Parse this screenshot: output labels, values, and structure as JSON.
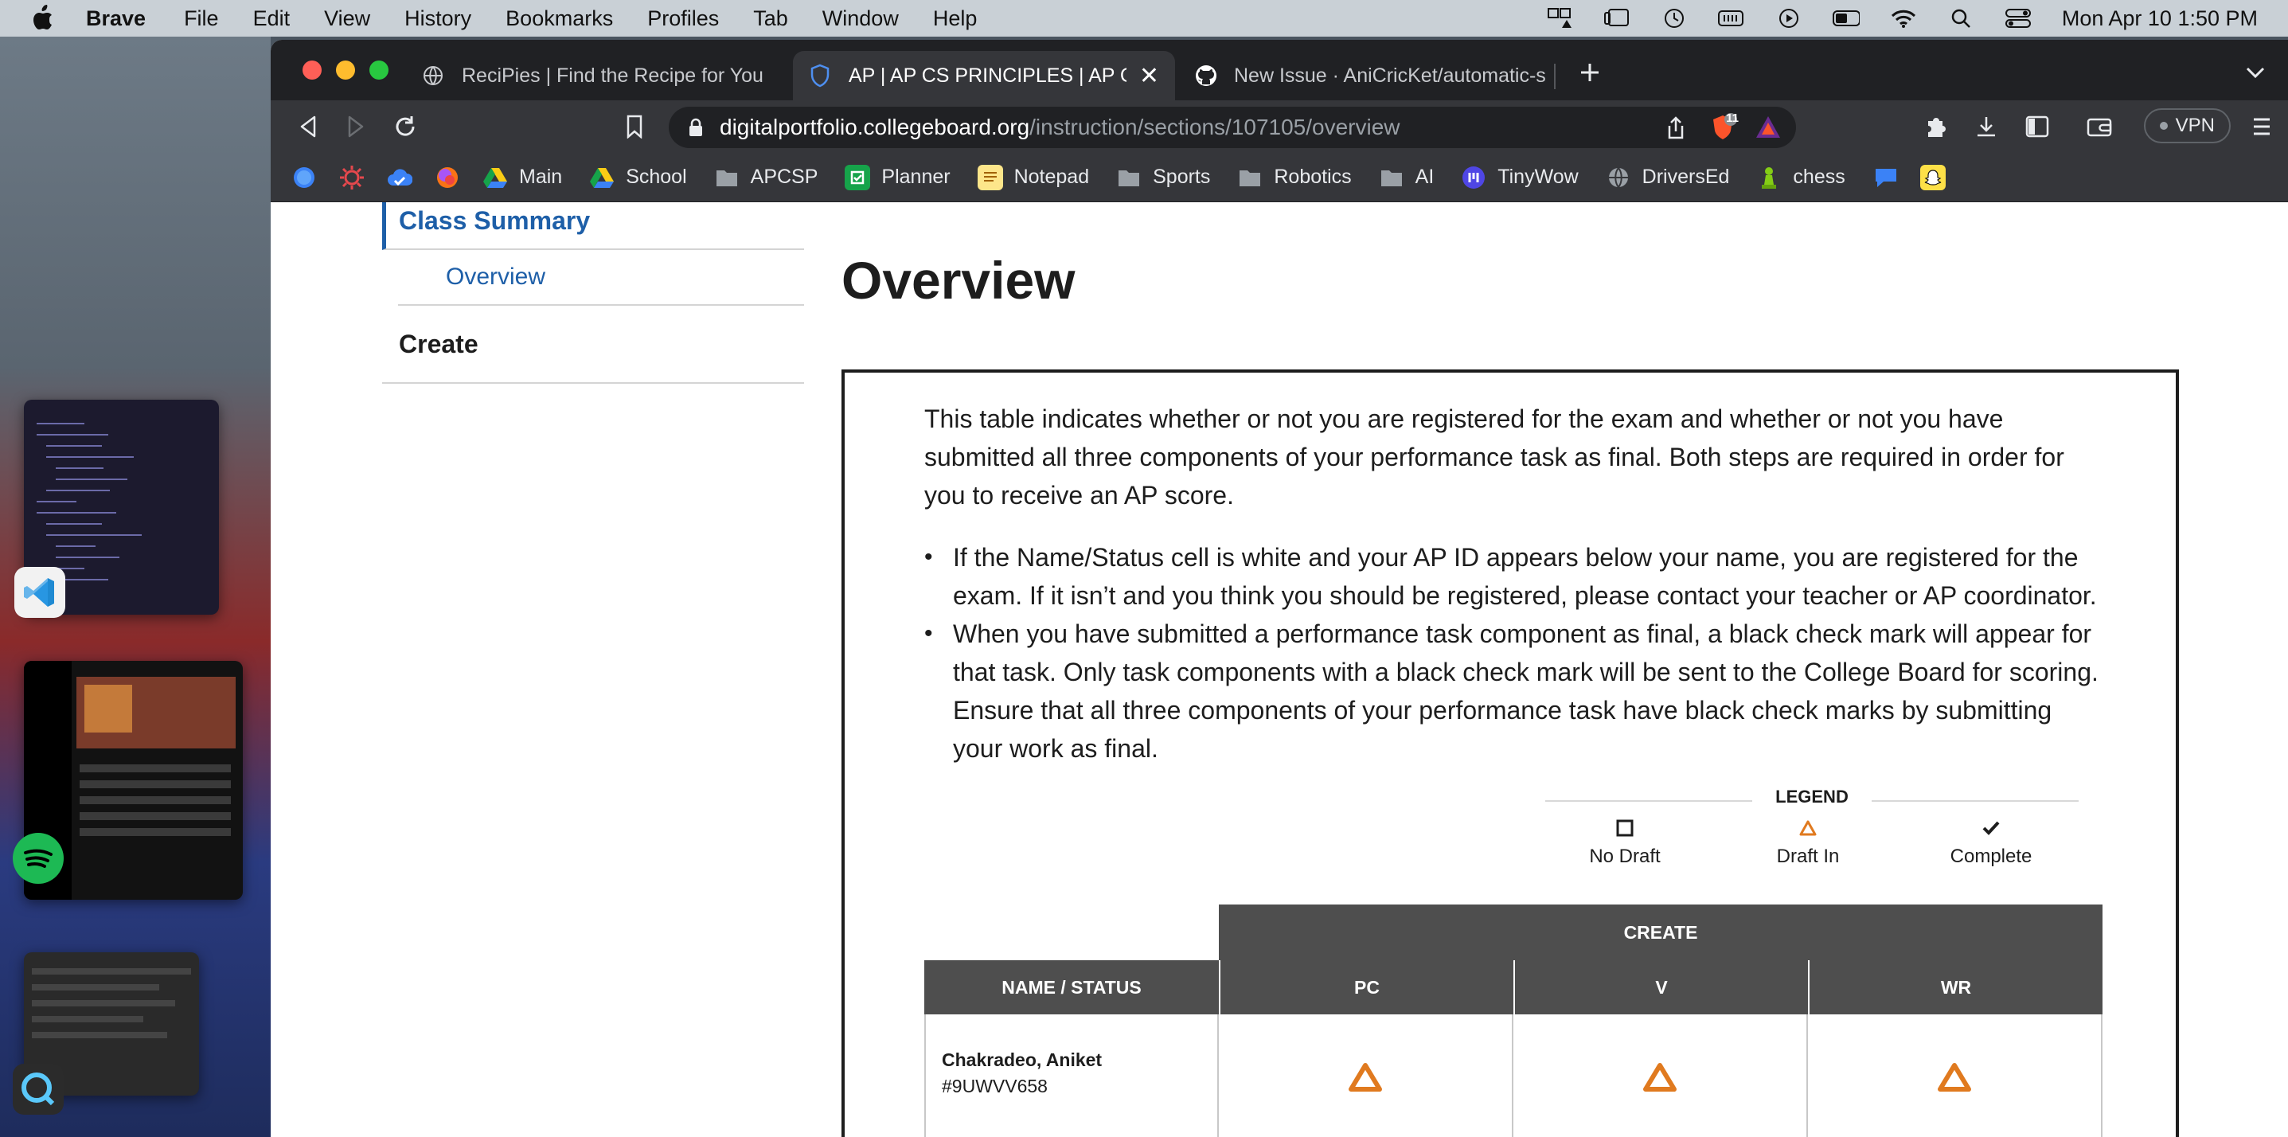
{
  "menubar": {
    "app": "Brave",
    "items": [
      "File",
      "Edit",
      "View",
      "History",
      "Bookmarks",
      "Profiles",
      "Tab",
      "Window",
      "Help"
    ],
    "clock": "Mon Apr 10  1:50 PM",
    "status_icons": [
      "screen-mirror-icon",
      "stage-manager-icon",
      "time-machine-icon",
      "battery-icon",
      "play-icon",
      "battery-level-icon",
      "wifi-icon",
      "spotlight-icon",
      "control-center-icon"
    ]
  },
  "tabs": [
    {
      "title": "ReciPies | Find the Recipe for You",
      "icon": "globe-icon",
      "active": false
    },
    {
      "title": "AP | AP CS PRINCIPLES | AP Co",
      "icon": "shield-icon",
      "active": true
    },
    {
      "title": "New Issue · AniCricKet/automatic-s",
      "icon": "github-icon",
      "active": false
    }
  ],
  "toolbar": {
    "url_host": "digitalportfolio.collegeboard.org",
    "url_path": "/instruction/sections/107105/overview",
    "brave_shield_count": "11",
    "vpn_label": "VPN"
  },
  "bookmarks": [
    {
      "label": "",
      "icon": "blue-circle-icon",
      "color": "#3b82f6"
    },
    {
      "label": "",
      "icon": "sun-icon",
      "color": "#e5484d"
    },
    {
      "label": "",
      "icon": "cloud-icon",
      "color": "#3b82f6"
    },
    {
      "label": "",
      "icon": "swirl-icon",
      "color": "#a855f7"
    },
    {
      "label": "Main",
      "icon": "drive-icon",
      "color": "#facc15"
    },
    {
      "label": "School",
      "icon": "drive-icon",
      "color": "#facc15"
    },
    {
      "label": "APCSP",
      "icon": "folder-icon",
      "color": "#9aa0a6"
    },
    {
      "label": "Planner",
      "icon": "planner-icon",
      "color": "#16a34a"
    },
    {
      "label": "Notepad",
      "icon": "notepad-icon",
      "color": "#fde68a"
    },
    {
      "label": "Sports",
      "icon": "folder-icon",
      "color": "#9aa0a6"
    },
    {
      "label": "Robotics",
      "icon": "folder-icon",
      "color": "#9aa0a6"
    },
    {
      "label": "AI",
      "icon": "folder-icon",
      "color": "#9aa0a6"
    },
    {
      "label": "TinyWow",
      "icon": "tinywow-icon",
      "color": "#4f46e5"
    },
    {
      "label": "DriversEd",
      "icon": "globe-icon",
      "color": "#9aa0a6"
    },
    {
      "label": "chess",
      "icon": "pawn-icon",
      "color": "#84cc16"
    },
    {
      "label": "",
      "icon": "chat-icon",
      "color": "#3b82f6"
    },
    {
      "label": "",
      "icon": "snapchat-icon",
      "color": "#fde047"
    }
  ],
  "sidenav": {
    "section": "Class Summary",
    "sub": "Overview",
    "create": "Create"
  },
  "main": {
    "title": "Overview",
    "intro": "This table indicates whether or not you are registered for the exam and whether or not you have submitted all three components of your performance task as final. Both steps are required in order for you to receive an AP score.",
    "bullets": [
      "If the Name/Status cell is white and your AP ID appears below your name, you are registered for the exam. If it isn’t and you think you should be registered, please contact your teacher or AP coordinator.",
      "When you have submitted a performance task component as final, a black check mark will appear for that task. Only task components with a black check mark will be sent to the College Board for scoring. Ensure that all three components of your performance task have black check marks by submitting your work as final."
    ]
  },
  "legend": {
    "title": "LEGEND",
    "items": [
      {
        "label": "No Draft",
        "icon": "empty-square-icon"
      },
      {
        "label": "Draft In",
        "icon": "orange-triangle-icon"
      },
      {
        "label": "Complete",
        "icon": "checkmark-icon"
      }
    ]
  },
  "table": {
    "group_header": "CREATE",
    "columns": [
      "NAME / STATUS",
      "PC",
      "V",
      "WR"
    ],
    "rows": [
      {
        "name": "Chakradeo, Aniket",
        "ap_id": "#9UWVV658",
        "cells": [
          "Draft In",
          "Draft In",
          "Draft In"
        ]
      }
    ]
  },
  "colors": {
    "accent": "#1e5fa8",
    "table_header": "#4e4e4e",
    "draft_orange": "#e07a1f"
  }
}
